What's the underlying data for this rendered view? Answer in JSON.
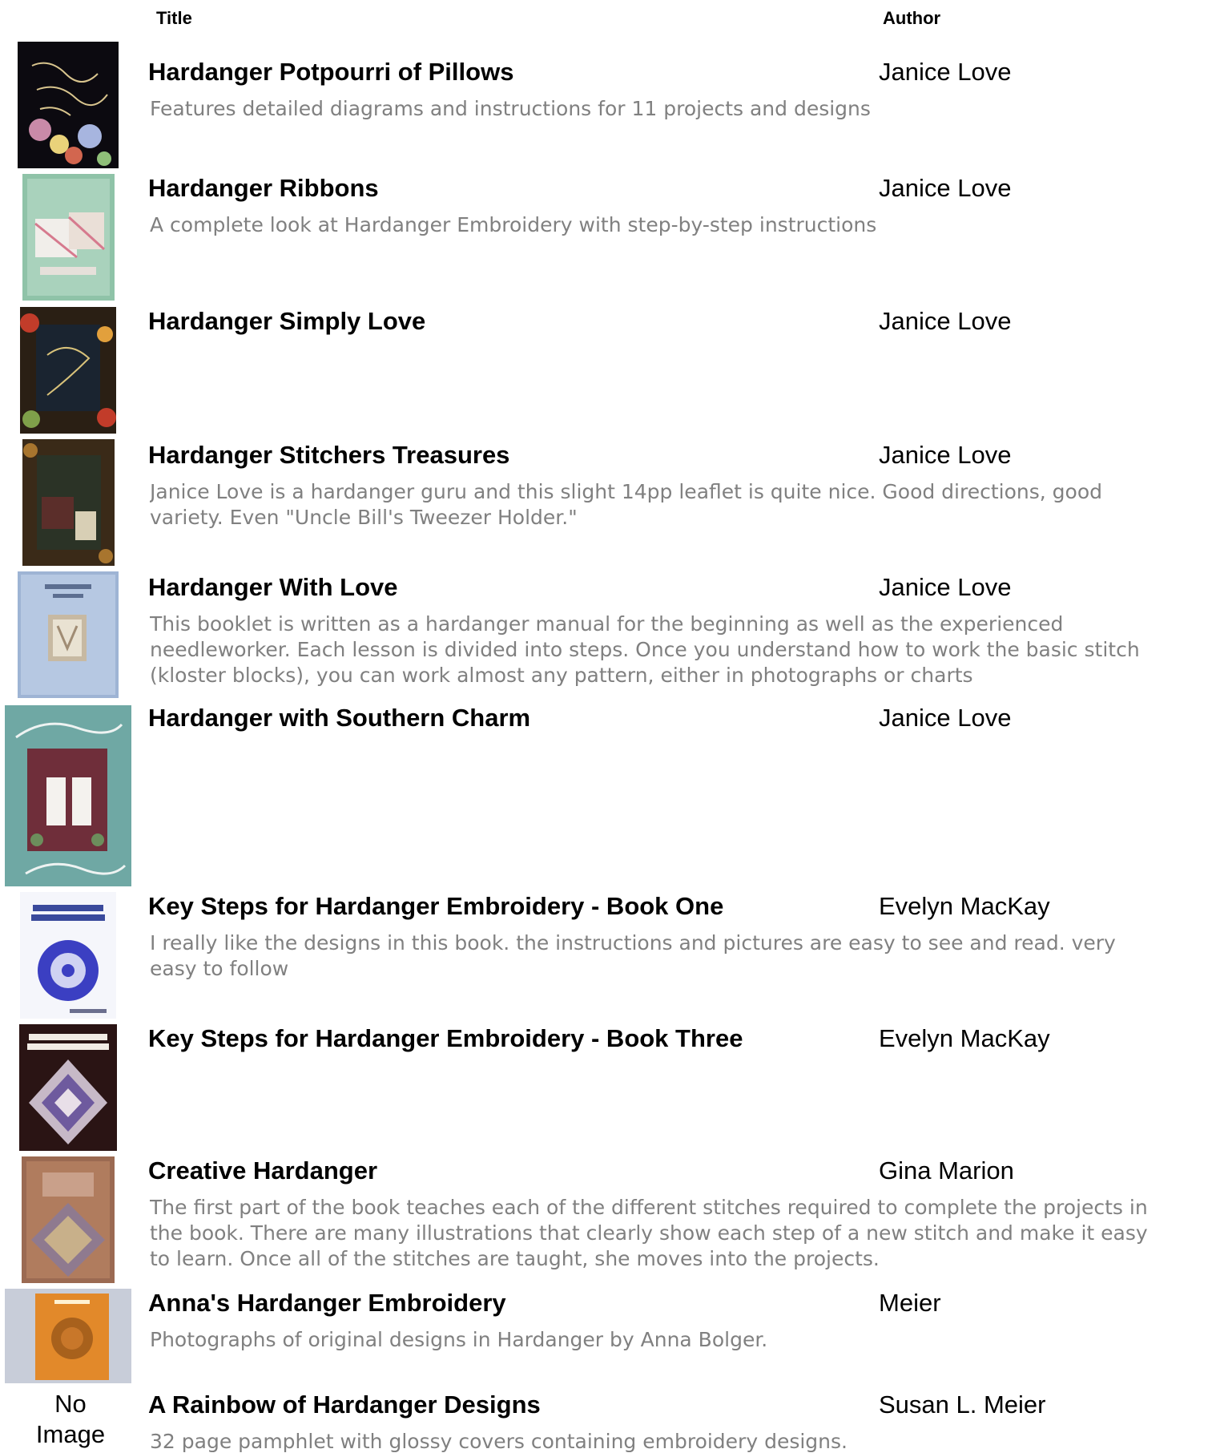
{
  "headers": {
    "title": "Title",
    "author": "Author"
  },
  "books": [
    {
      "title": "Hardanger Potpourri of Pillows",
      "author": "Janice Love",
      "description": [
        "Features detailed diagrams and instructions for 11 projects and designs"
      ],
      "image": "cover-potpourri-of-pillows"
    },
    {
      "title": "Hardanger Ribbons",
      "author": "Janice Love",
      "description": [
        "A complete look at Hardanger Embroidery with step-by-step instructions"
      ],
      "image": "cover-ribbons"
    },
    {
      "title": "Hardanger Simply Love",
      "author": "Janice Love",
      "description": [],
      "image": "cover-simply-love"
    },
    {
      "title": "Hardanger Stitchers Treasures",
      "author": "Janice Love",
      "description": [
        "Janice Love is a hardanger guru and this slight 14pp leaflet is quite nice. Good directions, good",
        "variety. Even \"Uncle Bill's Tweezer Holder.\""
      ],
      "image": "cover-stitchers-treasures"
    },
    {
      "title": "Hardanger With Love",
      "author": "Janice Love",
      "description": [
        "This booklet is written as a hardanger manual for the beginning as well as the experienced",
        "needleworker. Each lesson is divided into steps. Once you understand how to work the basic stitch",
        "(kloster blocks), you can work almost any pattern, either in photographs or charts"
      ],
      "image": "cover-with-love"
    },
    {
      "title": "Hardanger with Southern Charm",
      "author": "Janice Love",
      "description": [],
      "image": "cover-southern-charm"
    },
    {
      "title": "Key Steps for Hardanger Embroidery - Book One",
      "author": "Evelyn MacKay",
      "description": [
        "I really like the designs in this book. the instructions and pictures are easy to see and read. very",
        "easy to follow"
      ],
      "image": "cover-key-steps-one"
    },
    {
      "title": "Key Steps for Hardanger Embroidery - Book Three",
      "author": "Evelyn MacKay",
      "description": [],
      "image": "cover-key-steps-three"
    },
    {
      "title": "Creative Hardanger",
      "author": "Gina Marion",
      "description": [
        "The first part of the book teaches each of the different stitches required to complete the projects in",
        "the book. There are many illustrations that clearly show each step of a new stitch and make it easy",
        "to learn. Once all of the stitches are taught, she moves into the projects."
      ],
      "image": "cover-creative-hardanger"
    },
    {
      "title": "Anna's Hardanger Embroidery",
      "author": "Meier",
      "description": [
        "Photographs of original designs in Hardanger by Anna Bolger."
      ],
      "image": "cover-annas-hardanger"
    },
    {
      "title": "A Rainbow of Hardanger Designs",
      "author": "Susan L. Meier",
      "description": [
        "32 page pamphlet with glossy covers containing embroidery designs."
      ],
      "image": "no-image",
      "no_image_text": [
        "No",
        "Image"
      ]
    }
  ]
}
